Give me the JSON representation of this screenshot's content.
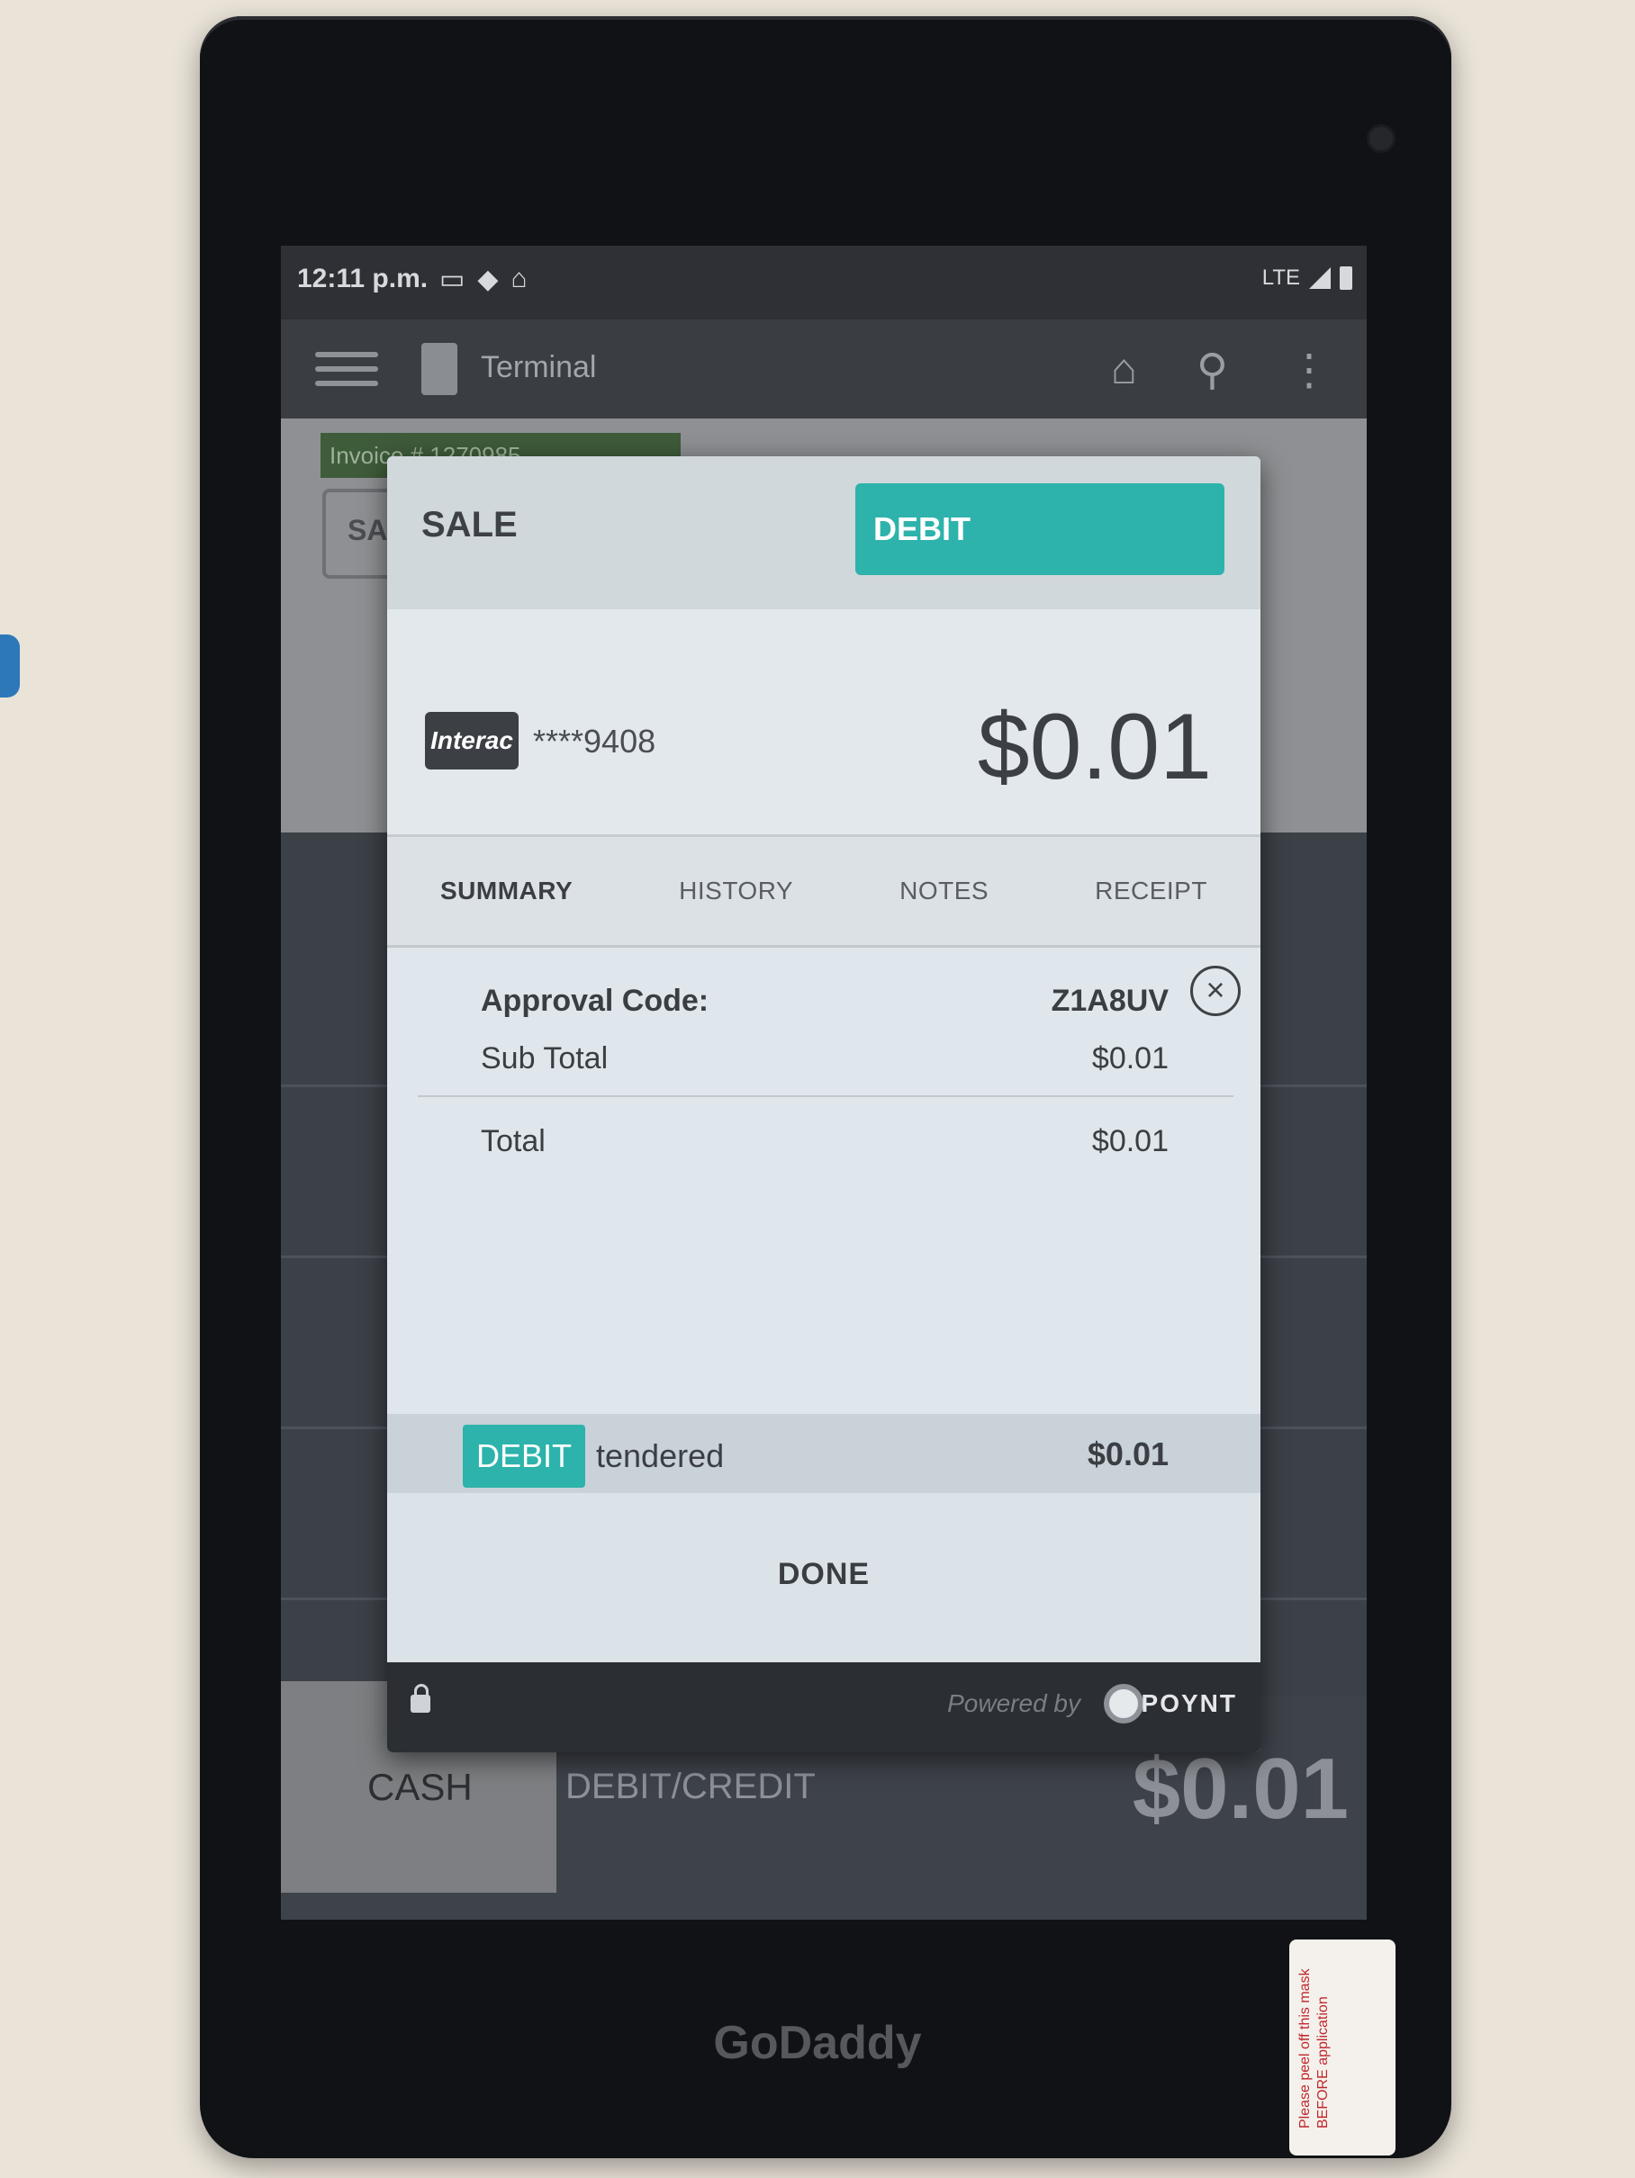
{
  "status_bar": {
    "time": "12:11 p.m.",
    "network": "LTE"
  },
  "app_bar": {
    "title": "Terminal"
  },
  "background": {
    "invoice_label": "Invoice # 1270985",
    "sale_tab_partial": "SA",
    "cash_button": "CASH",
    "debit_credit_label": "DEBIT/CREDIT",
    "total": "$0.01"
  },
  "modal": {
    "title": "SALE",
    "payment_method": "DEBIT",
    "card_brand": "Interac",
    "card_number": "****9408",
    "amount": "$0.01",
    "tabs": [
      "SUMMARY",
      "HISTORY",
      "NOTES",
      "RECEIPT"
    ],
    "active_tab": "SUMMARY",
    "summary": {
      "approval_label": "Approval Code:",
      "approval_value": "Z1A8UV",
      "subtotal_label": "Sub Total",
      "subtotal_value": "$0.01",
      "total_label": "Total",
      "total_value": "$0.01"
    },
    "tender": {
      "method": "DEBIT",
      "label": "tendered",
      "amount": "$0.01"
    },
    "done_label": "DONE",
    "footer": {
      "powered_by": "Powered by",
      "provider": "POYNT"
    }
  },
  "device": {
    "brand": "GoDaddy",
    "sticker_text": "Please peel off this mask BEFORE application"
  },
  "colors": {
    "accent": "#2db3ab",
    "modal_bg": "#d7dde1",
    "footer_bg": "#2b2e33"
  }
}
